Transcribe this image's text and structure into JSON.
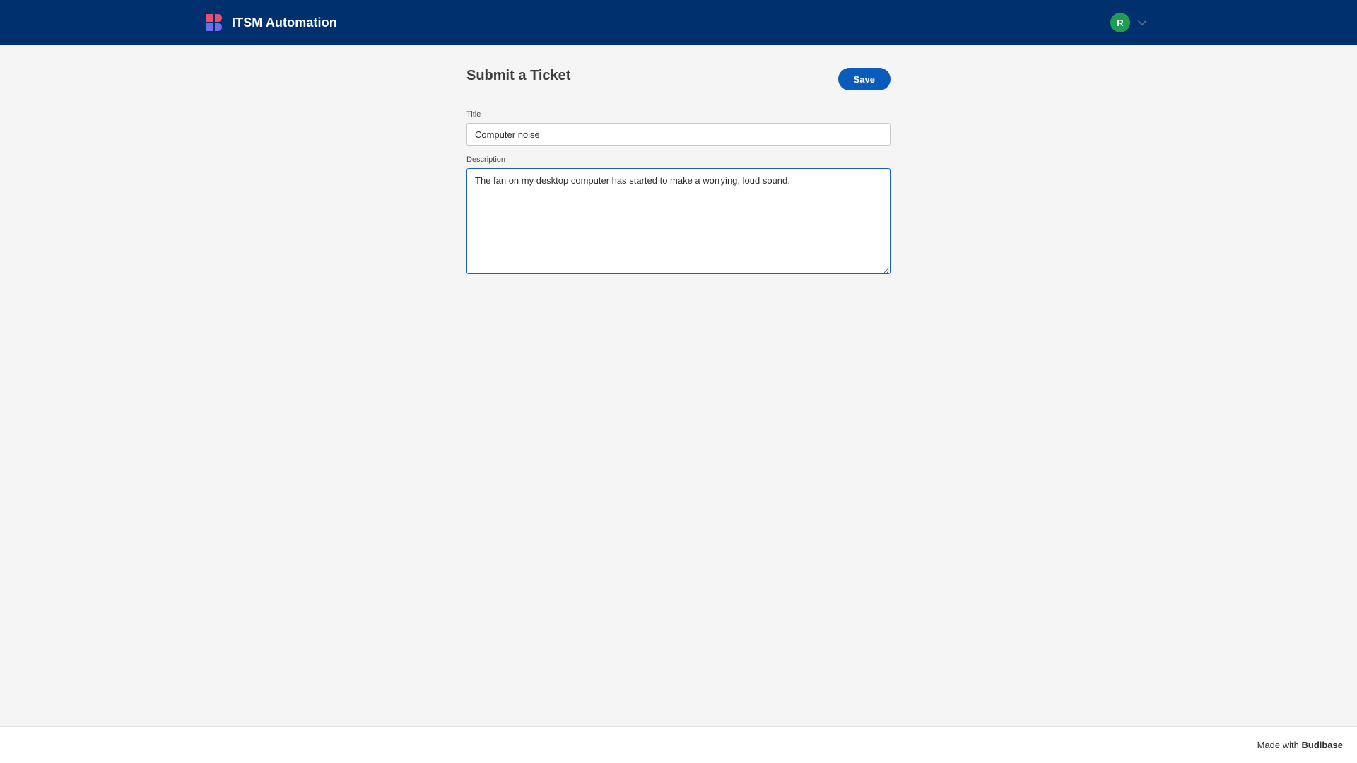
{
  "header": {
    "app_title": "ITSM Automation",
    "logo_icon": "budibase-logo-icon",
    "user_initial": "R",
    "avatar_color": "#1f9d55",
    "bar_color": "#00306d"
  },
  "main": {
    "page_title": "Submit a Ticket",
    "save_label": "Save",
    "title_label": "Title",
    "title_value": "Computer noise",
    "description_label": "Description",
    "description_value": "The fan on my desktop computer has started to make a worrying, loud sound."
  },
  "footer": {
    "made_with": "Made with",
    "brand": "Budibase"
  }
}
